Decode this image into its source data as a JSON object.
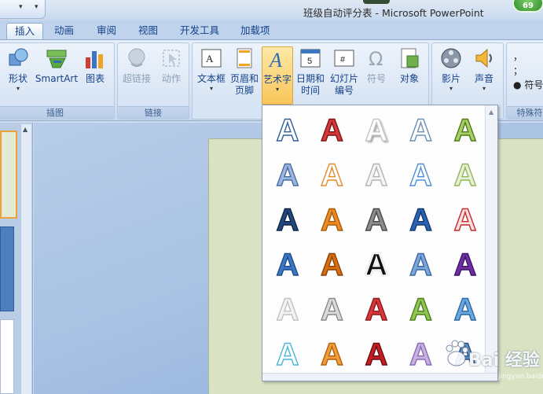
{
  "window": {
    "title": "班级自动评分表 - Microsoft PowerPoint",
    "badge": "69"
  },
  "tabs": [
    {
      "label": "插入",
      "active": true
    },
    {
      "label": "动画"
    },
    {
      "label": "审阅"
    },
    {
      "label": "视图"
    },
    {
      "label": "开发工具"
    },
    {
      "label": "加载项"
    }
  ],
  "ribbon": {
    "illustrations": {
      "label": "插图",
      "buttons": [
        "形状",
        "SmartArt",
        "图表"
      ]
    },
    "links": {
      "label": "链接",
      "buttons": [
        "超链接",
        "动作"
      ]
    },
    "text": {
      "buttons": [
        "文本框",
        "页眉和页脚",
        "艺术字",
        "日期和时间",
        "幻灯片编号",
        "符号",
        "对象"
      ]
    },
    "media": {
      "buttons": [
        "影片",
        "声音"
      ]
    },
    "special": {
      "label": "特殊符",
      "items": [
        "，",
        "；",
        "：",
        "●",
        "符号"
      ]
    }
  },
  "wordart_gallery": {
    "styles": [
      [
        "fill-none-outline-blue",
        "fill-red-outline",
        "fill-white-shadow",
        "fill-white-outline-blue",
        "fill-lightgreen-outline"
      ],
      [
        "fill-blue-soft",
        "fill-white-outline-orange",
        "fill-white-outline-gray",
        "fill-white-outline-lightblue",
        "fill-white-outline-green"
      ],
      [
        "fill-navy-bevel",
        "fill-orange-bevel",
        "fill-gray-bevel",
        "fill-blue-gradient",
        "fill-white-outline-red"
      ],
      [
        "fill-blue-reflect",
        "fill-orange-dark",
        "fill-black-outline",
        "fill-lightblue-gradient",
        "fill-purple"
      ],
      [
        "fill-white-gray",
        "fill-gray-outline",
        "fill-red-gradient",
        "fill-green-gradient",
        "fill-blue-light"
      ],
      [
        "fill-white-outline-cyan",
        "fill-orange-light",
        "fill-red-dark",
        "fill-lavender",
        "fill-blue-steel"
      ]
    ],
    "colors": {
      "accent_blue": "#2e6cb5",
      "accent_orange": "#e47a1a",
      "accent_red": "#c8282d",
      "accent_green": "#77b843",
      "accent_purple": "#6d2fa2"
    }
  },
  "watermark": {
    "text": "Bai 经验",
    "sub": "jingyan.baidu.com"
  }
}
